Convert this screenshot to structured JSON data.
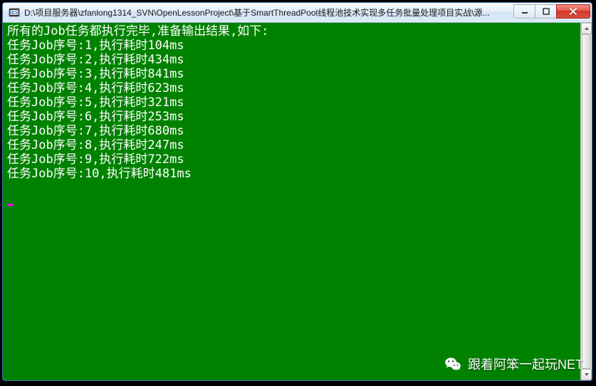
{
  "window": {
    "title": "D:\\项目服务器\\zfanlong1314_SVN\\OpenLessonProject\\基于SmartThreadPool线程池技术实现多任务批量处理项目实战\\源...",
    "min_label": "_",
    "max_label": "□",
    "close_label": "X"
  },
  "console": {
    "header": "所有的Job任务都执行完毕,准备输出结果,如下:",
    "line_prefix": "任务Job序号:",
    "line_mid": ",执行耗时",
    "line_suffix": "ms",
    "rows": [
      {
        "idx": "1",
        "ms": "104"
      },
      {
        "idx": "2",
        "ms": "434"
      },
      {
        "idx": "3",
        "ms": "841"
      },
      {
        "idx": "4",
        "ms": "623"
      },
      {
        "idx": "5",
        "ms": "321"
      },
      {
        "idx": "6",
        "ms": "253"
      },
      {
        "idx": "7",
        "ms": "680"
      },
      {
        "idx": "8",
        "ms": "247"
      },
      {
        "idx": "9",
        "ms": "722"
      },
      {
        "idx": "10",
        "ms": "481"
      }
    ]
  },
  "watermark": {
    "text": "跟着阿笨一起玩NET"
  }
}
